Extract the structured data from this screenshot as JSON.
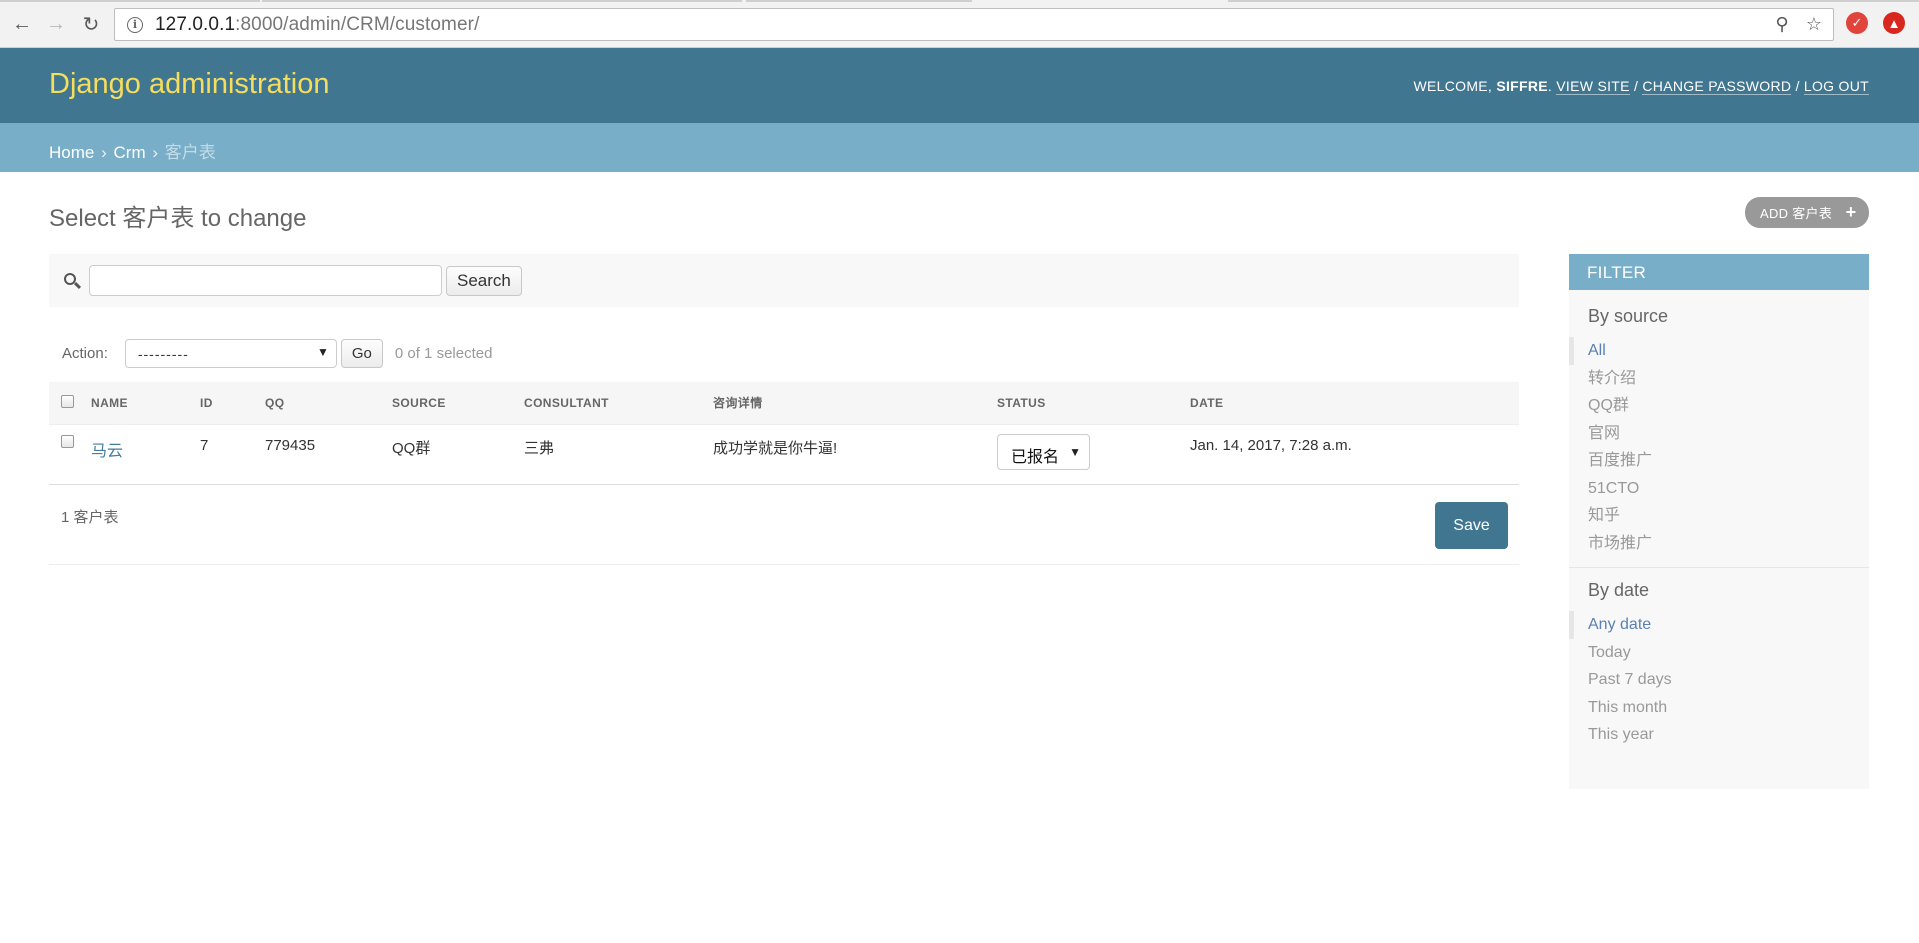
{
  "browser": {
    "url_host": "127.0.0.1",
    "url_path": ":8000/admin/CRM/customer/"
  },
  "header": {
    "branding": "Django administration",
    "welcome": "WELCOME, ",
    "username": "SIFFRE",
    "view_site": "VIEW SITE",
    "change_password": "CHANGE PASSWORD",
    "log_out": "LOG OUT"
  },
  "breadcrumbs": {
    "home": "Home",
    "app": "Crm",
    "current": "客户表"
  },
  "content": {
    "title": "Select 客户表 to change",
    "add_button": "ADD 客户表"
  },
  "search": {
    "value": "",
    "button": "Search"
  },
  "actions": {
    "label": "Action:",
    "selected_option": "---------",
    "go_button": "Go",
    "counter": "0 of 1 selected"
  },
  "table": {
    "columns": [
      "NAME",
      "ID",
      "QQ",
      "SOURCE",
      "CONSULTANT",
      "咨询详情",
      "STATUS",
      "DATE"
    ],
    "rows": [
      {
        "name": "马云",
        "id": "7",
        "qq": "779435",
        "source": "QQ群",
        "consultant": "三弗",
        "detail": "成功学就是你牛逼!",
        "status": "已报名",
        "date": "Jan. 14, 2017, 7:28 a.m."
      }
    ]
  },
  "paginator": {
    "count": "1 客户表",
    "save_button": "Save"
  },
  "filter": {
    "title": "FILTER",
    "groups": [
      {
        "heading": "By source",
        "options": [
          "All",
          "转介绍",
          "QQ群",
          "官网",
          "百度推广",
          "51CTO",
          "知乎",
          "市场推广"
        ]
      },
      {
        "heading": "By date",
        "options": [
          "Any date",
          "Today",
          "Past 7 days",
          "This month",
          "This year"
        ]
      }
    ]
  }
}
